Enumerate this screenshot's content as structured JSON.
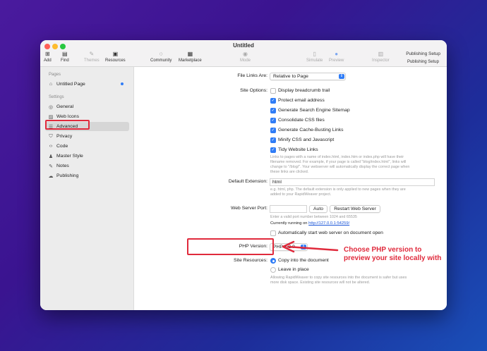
{
  "window": {
    "title": "Untitled"
  },
  "toolbar": {
    "items": [
      {
        "label": "Add",
        "icon": "plus-square-icon"
      },
      {
        "label": "Find",
        "icon": "find-icon"
      },
      {
        "label": "Themes",
        "icon": "brush-icon"
      },
      {
        "label": "Resources",
        "icon": "resources-icon"
      },
      {
        "label": "Community",
        "icon": "chat-icon"
      },
      {
        "label": "Marketplace",
        "icon": "store-icon"
      },
      {
        "label": "Mode",
        "icon": "eye-icon"
      },
      {
        "label": "Simulate",
        "icon": "device-icon"
      },
      {
        "label": "Preview",
        "icon": "preview-icon"
      },
      {
        "label": "Inspector",
        "icon": "inspector-icon"
      }
    ],
    "publishing_title": "Publishing Setup",
    "publishing_sub": "Publishing Setup"
  },
  "sidebar": {
    "pages_header": "Pages",
    "page_item": "Untitled Page",
    "settings_header": "Settings",
    "items": [
      {
        "label": "General",
        "icon": "globe-icon"
      },
      {
        "label": "Web Icons",
        "icon": "image-icon"
      },
      {
        "label": "Advanced",
        "icon": "sliders-icon"
      },
      {
        "label": "Privacy",
        "icon": "shield-icon"
      },
      {
        "label": "Code",
        "icon": "code-icon"
      },
      {
        "label": "Master Style",
        "icon": "person-icon"
      },
      {
        "label": "Notes",
        "icon": "notes-icon"
      },
      {
        "label": "Publishing",
        "icon": "cloud-icon"
      }
    ]
  },
  "main": {
    "file_links_label": "File Links Are:",
    "file_links_value": "Relative to Page",
    "site_options_label": "Site Options:",
    "options": [
      {
        "label": "Display breadcrumb trail",
        "checked": false
      },
      {
        "label": "Protect email address",
        "checked": true
      },
      {
        "label": "Generate Search Engine Sitemap",
        "checked": true
      },
      {
        "label": "Consolidate CSS files",
        "checked": true
      },
      {
        "label": "Generate Cache-Busting Links",
        "checked": true
      },
      {
        "label": "Minify CSS and Javascript",
        "checked": true
      },
      {
        "label": "Tidy Website Links",
        "checked": true
      }
    ],
    "tidy_note_1": "Links to pages with a name of index.html, index.htm or index.php will have their",
    "tidy_note_2": "filename removed. For example, if your page is called \"blog/index.html\", links will",
    "tidy_note_3": "change to \"/blog/\". Your webserver will automatically display the correct page when",
    "tidy_note_4": "these links are clicked.",
    "default_ext_label": "Default Extension:",
    "default_ext_value": "html",
    "ext_note_1": "e.g. html, php. The default extension is only applied to new pages when they are",
    "ext_note_2": "added to your RapidWeaver project.",
    "server_port_label": "Web Server Port:",
    "server_port_value": "",
    "auto_button": "Auto",
    "restart_button": "Restart Web Server",
    "port_note": "Enter a valid port number between 1024 and 65535",
    "running_prefix": "Currently running on",
    "running_url": "http://127.0.0.1:54259/",
    "auto_start_label": "Automatically start web server on document open",
    "php_label": "PHP Version:",
    "php_value": "PHP 8.2.9",
    "site_resources_label": "Site Resources:",
    "resource_copy": "Copy into the document",
    "resource_leave": "Leave in place",
    "resource_note_1": "Allowing RapidWeaver to copy site resources into the document is safer but uses",
    "resource_note_2": "more disk space. Existing site resources will not be altered."
  },
  "annotation": {
    "text": "Choose PHP version to preview your site locally with",
    "color": "#e02a3c"
  }
}
